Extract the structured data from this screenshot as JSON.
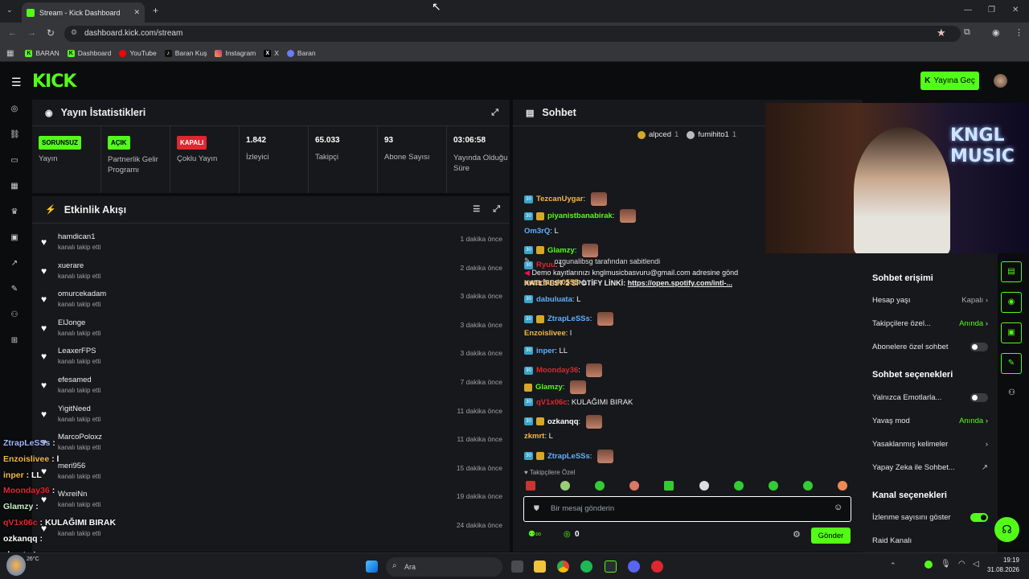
{
  "browser": {
    "tab_title": "Stream - Kick Dashboard",
    "url": "dashboard.kick.com/stream",
    "bookmarks": [
      "BARAN",
      "Dashboard",
      "YouTube",
      "Baran Kuş",
      "Instagram",
      "X",
      "Baran"
    ]
  },
  "header": {
    "logo": "KICK",
    "go_live": "Yayına Geç"
  },
  "stats": {
    "title": "Yayın İstatistikleri",
    "items": [
      {
        "badge": "SORUNSUZ",
        "label": "Yayın",
        "color": "#53fc18"
      },
      {
        "badge": "AÇIK",
        "label": "Partnerlik Gelir Programı",
        "color": "#53fc18"
      },
      {
        "badge": "KAPALI",
        "label": "Çoklu Yayın",
        "color": "#e0262f"
      },
      {
        "value": "1.842",
        "label": "İzleyici"
      },
      {
        "value": "65.033",
        "label": "Takipçi"
      },
      {
        "value": "93",
        "label": "Abone Sayısı"
      },
      {
        "value": "03:06:58",
        "label": "Yayında Olduğu Süre"
      }
    ]
  },
  "activity": {
    "title": "Etkinlik Akışı",
    "items": [
      {
        "name": "hamdican1",
        "action": "kanalı takip etti",
        "time": "1 dakika önce"
      },
      {
        "name": "xuerare",
        "action": "kanalı takip etti",
        "time": "2 dakika önce"
      },
      {
        "name": "omurcekadam",
        "action": "kanalı takip etti",
        "time": "3 dakika önce"
      },
      {
        "name": "ElJonge",
        "action": "kanalı takip etti",
        "time": "3 dakika önce"
      },
      {
        "name": "LeaxerFPS",
        "action": "kanalı takip etti",
        "time": "3 dakika önce"
      },
      {
        "name": "efesamed",
        "action": "kanalı takip etti",
        "time": "7 dakika önce"
      },
      {
        "name": "YigitNeed",
        "action": "kanalı takip etti",
        "time": "11 dakika önce"
      },
      {
        "name": "MarcoPoloxz",
        "action": "kanalı takip etti",
        "time": "11 dakika önce"
      },
      {
        "name": "meri956",
        "action": "kanalı takip etti",
        "time": "15 dakika önce"
      },
      {
        "name": "WxreiNn",
        "action": "kanalı takip etti",
        "time": "19 dakika önce"
      },
      {
        "name": "",
        "action": "kanalı takip etti",
        "time": "24 dakika önce"
      }
    ]
  },
  "chat": {
    "title": "Sohbet",
    "top_users": [
      {
        "name": "alpced",
        "count": "1"
      },
      {
        "name": "fumihito1",
        "count": "1"
      }
    ],
    "pinned_by": "ozgunalibsg tarafından sabitlendi",
    "pinned_line1": "Demo kayıtlarınızı knglmusicbasvuru@gmail.com adresine gönd",
    "pinned_line2_prefix": "KATLİFEST 2 SPOTİFY LİNKİ: ",
    "pinned_link": "https://open.spotify.com/intl-...",
    "messages": [
      {
        "user": "TezcanUygar",
        "text": "",
        "color": "#f2b84b"
      },
      {
        "user": "piyanistbanabirak",
        "text": "",
        "color": "#53fc18"
      },
      {
        "user": "Om3rQ",
        "text": "L",
        "color": "#5fb0ff"
      },
      {
        "user": "Glamzy",
        "text": "",
        "color": "#53fc18"
      },
      {
        "user": "Ryuu",
        "text": "L",
        "color": "#e0262f"
      },
      {
        "user": "omerfaruk0555",
        "text": "L",
        "color": "#f2b84b"
      },
      {
        "user": "dabuluata",
        "text": "L",
        "color": "#5fb0ff"
      },
      {
        "user": "ZtrapLeSSs",
        "text": "",
        "color": "#5fb0ff"
      },
      {
        "user": "Enzoislivee",
        "text": "l",
        "color": "#f2b84b"
      },
      {
        "user": "inper",
        "text": "LL",
        "color": "#5fb0ff"
      },
      {
        "user": "Moonday36",
        "text": "",
        "color": "#e0262f"
      },
      {
        "user": "Glamzy",
        "text": "",
        "color": "#53fc18"
      },
      {
        "user": "qV1x06c",
        "text": "KULAĞIMI BIRAK",
        "color": "#e0262f"
      },
      {
        "user": "ozkanqq",
        "text": "",
        "color": "#ffffff"
      },
      {
        "user": "zkmrt",
        "text": "L",
        "color": "#f2b84b"
      },
      {
        "user": "ZtrapLeSSs",
        "text": "",
        "color": "#5fb0ff"
      }
    ],
    "followers_only": "Takipçilere Özel",
    "input_placeholder": "Bir mesaj gönderin",
    "points": "0",
    "send": "Gönder"
  },
  "settings": {
    "access_title": "Sohbet erişimi",
    "account_age": "Hesap yaşı",
    "account_age_value": "Kapalı",
    "followers_only": "Takipçilere özel...",
    "followers_only_value": "Anında",
    "subs_only": "Abonelere özel sohbet",
    "options_title": "Sohbet seçenekleri",
    "emotes_only": "Yalnızca Emotlarla...",
    "slow_mode": "Yavaş mod",
    "slow_mode_value": "Anında",
    "banned_words": "Yasaklanmış kelimeler",
    "ai_chat": "Yapay Zeka ile Sohbet...",
    "channel_title": "Kanal seçenekleri",
    "show_viewers": "İzlenme sayısını göster",
    "raid_channel": "Raid Kanalı"
  },
  "overlay": [
    {
      "user": "ZtrapLeSSs",
      "text": ":",
      "color": "#9fb6ff"
    },
    {
      "user": "Enzoislivee",
      "text": ": l",
      "color": "#f2b84b"
    },
    {
      "user": "inper",
      "text": ": LL",
      "color": "#f2b84b"
    },
    {
      "user": "Moonday36",
      "text": ":",
      "color": "#e0262f"
    },
    {
      "user": "Glamzy",
      "text": ":",
      "color": "#c8f0c8"
    },
    {
      "user": "qV1x06c",
      "text": ": KULAĞIMI BIRAK",
      "color": "#e0262f"
    },
    {
      "user": "ozkanqq",
      "text": ":",
      "color": "#ffffff"
    },
    {
      "user": "zkmrt",
      "text": ": L",
      "color": "#ffffff"
    },
    {
      "user": "ZtrapLeSSs",
      "text": ":",
      "color": "#9fb6ff"
    }
  ],
  "taskbar": {
    "search": "Ara",
    "time": "19:19",
    "date": "31.08.2026",
    "weather": "26°C"
  },
  "webcam": {
    "sign": "KNGL MUSIC"
  }
}
